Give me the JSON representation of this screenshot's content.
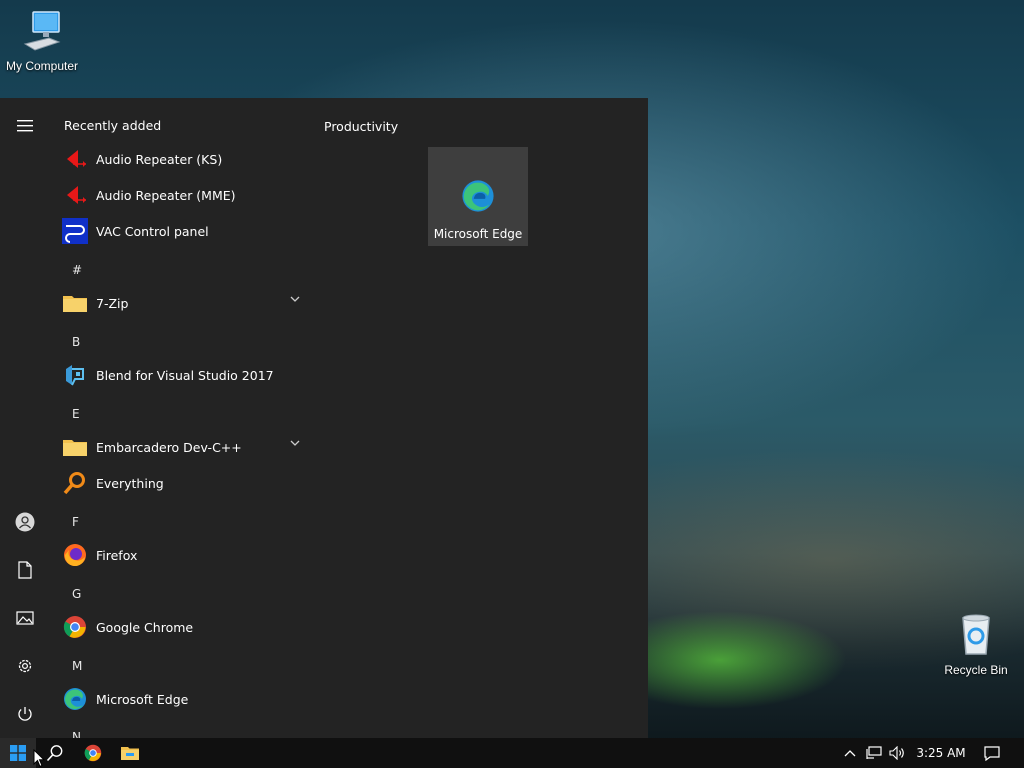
{
  "desktop": {
    "my_computer": "My Computer",
    "recycle_bin": "Recycle Bin"
  },
  "start_menu": {
    "recently_added_header": "Recently added",
    "recent_items": [
      {
        "label": "Audio Repeater (KS)",
        "icon": "speaker-red-icon"
      },
      {
        "label": "Audio Repeater (MME)",
        "icon": "speaker-red-icon"
      },
      {
        "label": "VAC Control panel",
        "icon": "vac-control-icon"
      }
    ],
    "sections": [
      {
        "letter": "#",
        "apps": [
          {
            "label": "7-Zip",
            "icon": "folder-icon",
            "expandable": true
          }
        ]
      },
      {
        "letter": "B",
        "apps": [
          {
            "label": "Blend for Visual Studio 2017",
            "icon": "blend-icon"
          }
        ]
      },
      {
        "letter": "E",
        "apps": [
          {
            "label": "Embarcadero Dev-C++",
            "icon": "folder-icon",
            "expandable": true
          },
          {
            "label": "Everything",
            "icon": "magnifier-orange-icon"
          }
        ]
      },
      {
        "letter": "F",
        "apps": [
          {
            "label": "Firefox",
            "icon": "firefox-icon"
          }
        ]
      },
      {
        "letter": "G",
        "apps": [
          {
            "label": "Google Chrome",
            "icon": "chrome-icon"
          }
        ]
      },
      {
        "letter": "M",
        "apps": [
          {
            "label": "Microsoft Edge",
            "icon": "edge-icon"
          }
        ]
      },
      {
        "letter": "N",
        "apps": []
      }
    ],
    "tiles_group": "Productivity",
    "tiles": [
      {
        "label": "Microsoft Edge",
        "icon": "edge-icon"
      }
    ]
  },
  "taskbar": {
    "time": "3:25 AM"
  },
  "colors": {
    "start_bg": "#232323",
    "tile_bg": "#3e3e3e",
    "taskbar_bg": "#101010",
    "accent_blue": "#0a84d8"
  }
}
